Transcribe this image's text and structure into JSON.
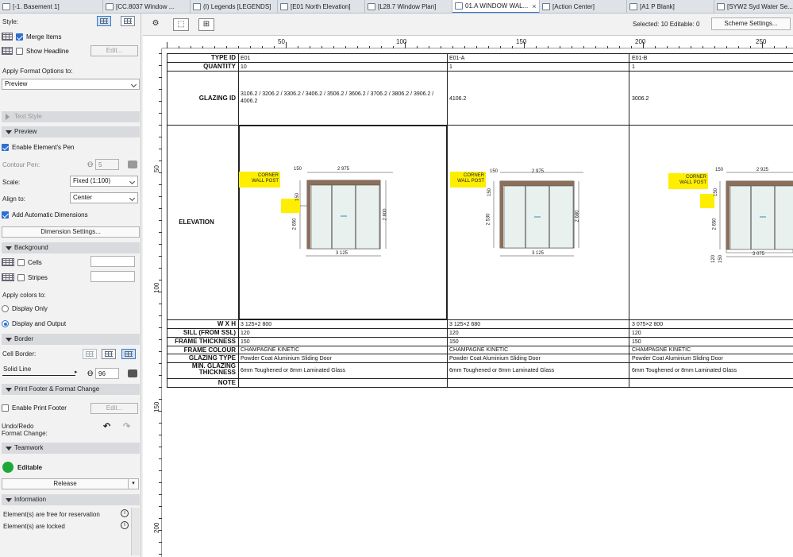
{
  "tabs": [
    {
      "label": "[-1. Basement 1]",
      "active": false
    },
    {
      "label": "[CC.8037 Window ...",
      "active": false
    },
    {
      "label": "(I) Legends [LEGENDS]",
      "active": false
    },
    {
      "label": "[E01 North Elevation]",
      "active": false
    },
    {
      "label": "[L28.7 Window Plan]",
      "active": false
    },
    {
      "label": "01.A WINDOW WAL...",
      "active": true,
      "close": "×"
    },
    {
      "label": "[Action Center]",
      "active": false
    },
    {
      "label": "[A1 P Blank]",
      "active": false
    },
    {
      "label": "[SYW2 Syd Water Se...",
      "active": false
    }
  ],
  "panel": {
    "style_label": "Style:",
    "merge_items": "Merge Items",
    "show_headline": "Show Headline",
    "edit_label": "Edit...",
    "apply_format_label": "Apply Format Options to:",
    "apply_format_value": "Preview",
    "text_style": "Text Style",
    "preview_section": "Preview",
    "enable_pen": "Enable Element's Pen",
    "contour_pen": "Contour Pen:",
    "contour_pen_value": "5",
    "scale_label": "Scale:",
    "scale_value": "Fixed (1:100)",
    "align_label": "Align to:",
    "align_value": "Center",
    "add_dims": "Add Automatic Dimensions",
    "dim_settings": "Dimension Settings...",
    "background_section": "Background",
    "cells": "Cells",
    "stripes": "Stripes",
    "apply_colors": "Apply colors to:",
    "display_only": "Display Only",
    "display_output": "Display and Output",
    "border_section": "Border",
    "cell_border": "Cell Border:",
    "line_type": "Solid Line",
    "pen_value": "96",
    "print_footer_section": "Print Footer & Format Change",
    "enable_footer": "Enable Print Footer",
    "undo_label_1": "Undo/Redo",
    "undo_label_2": "Format Change:",
    "teamwork_section": "Teamwork",
    "editable": "Editable",
    "release": "Release",
    "information_section": "Information",
    "info_1": "Element(s) are free for reservation",
    "info_2": "Element(s) are locked",
    "colors": {
      "accent": "#2d6fd2",
      "teamwork_green": "#1fa838"
    }
  },
  "toolbar": {
    "selected": "Selected: 10  Editable: 0",
    "scheme_settings": "Scheme Settings..."
  },
  "ruler": {
    "h_labels": [
      "50",
      "100",
      "150",
      "200",
      "250"
    ],
    "v_labels": [
      "50",
      "100",
      "150",
      "200"
    ]
  },
  "schedule": {
    "row_headers": {
      "type_id": "TYPE ID",
      "quantity": "QUANTITY",
      "glazing_id": "GLAZING ID",
      "elevation": "ELEVATION",
      "wxh": "W X H",
      "sill": "SILL (FROM SSL)",
      "frame_thickness": "FRAME THICKNESS",
      "frame_colour": "FRAME COLOUR",
      "glazing_type": "GLAZING TYPE",
      "min_glazing_1": "MIN. GLAZING",
      "min_glazing_2": "THICKNESS",
      "note": "NOTE"
    },
    "columns": [
      {
        "type_id": "E01",
        "quantity": "10",
        "glazing_id": "3106.2 / 3206.2 / 3306.2 / 3406.2 / 3506.2 / 3606.2 / 3706.2 / 3806.2 / 3906.2 / 4006.2",
        "wxh": "3 125×2 800",
        "sill": "120",
        "frame_thickness": "150",
        "frame_colour": "CHAMPAGNE KINETIC",
        "glazing_type": "Powder Coat Aluminium Sliding Door",
        "min_glazing": "6mm Toughened or 8mm Laminated Glass",
        "note": "",
        "callout_1": "CORNER",
        "callout_2": "WALL POST",
        "dim_top_a": "150",
        "dim_top_b": "2 975",
        "dim_left_a": "150",
        "dim_left_b": "2 650",
        "dim_right": "2 800",
        "dim_bottom": "3 125"
      },
      {
        "type_id": "E01-A",
        "quantity": "1",
        "glazing_id": "4106.2",
        "wxh": "3 125×2 680",
        "sill": "120",
        "frame_thickness": "150",
        "frame_colour": "CHAMPAGNE KINETIC",
        "glazing_type": "Powder Coat Aluminium Sliding Door",
        "min_glazing": "6mm Toughened or 8mm Laminated Glass",
        "note": "",
        "callout_1": "CORNER",
        "callout_2": "WALL POST",
        "dim_top_a": "150",
        "dim_top_b": "2 975",
        "dim_left_a": "150",
        "dim_left_b": "2 530",
        "dim_right": "2 680",
        "dim_bottom": "3 125"
      },
      {
        "type_id": "E01-B",
        "quantity": "1",
        "glazing_id": "3006.2",
        "wxh": "3 075×2 800",
        "sill": "120",
        "frame_thickness": "150",
        "frame_colour": "CHAMPAGNE KINETIC",
        "glazing_type": "Powder Coat Aluminium Sliding Door",
        "min_glazing": "6mm Toughened or 8mm Laminated Glass",
        "note": "",
        "callout_1": "CORNER",
        "callout_2": "WALL POST",
        "dim_top_a": "150",
        "dim_top_b": "2 925",
        "dim_left_a": "150",
        "dim_left_b": "2 650",
        "dim_bottom": "3 075",
        "dim_sill": "120",
        "dim_sill_b": "150"
      }
    ]
  }
}
